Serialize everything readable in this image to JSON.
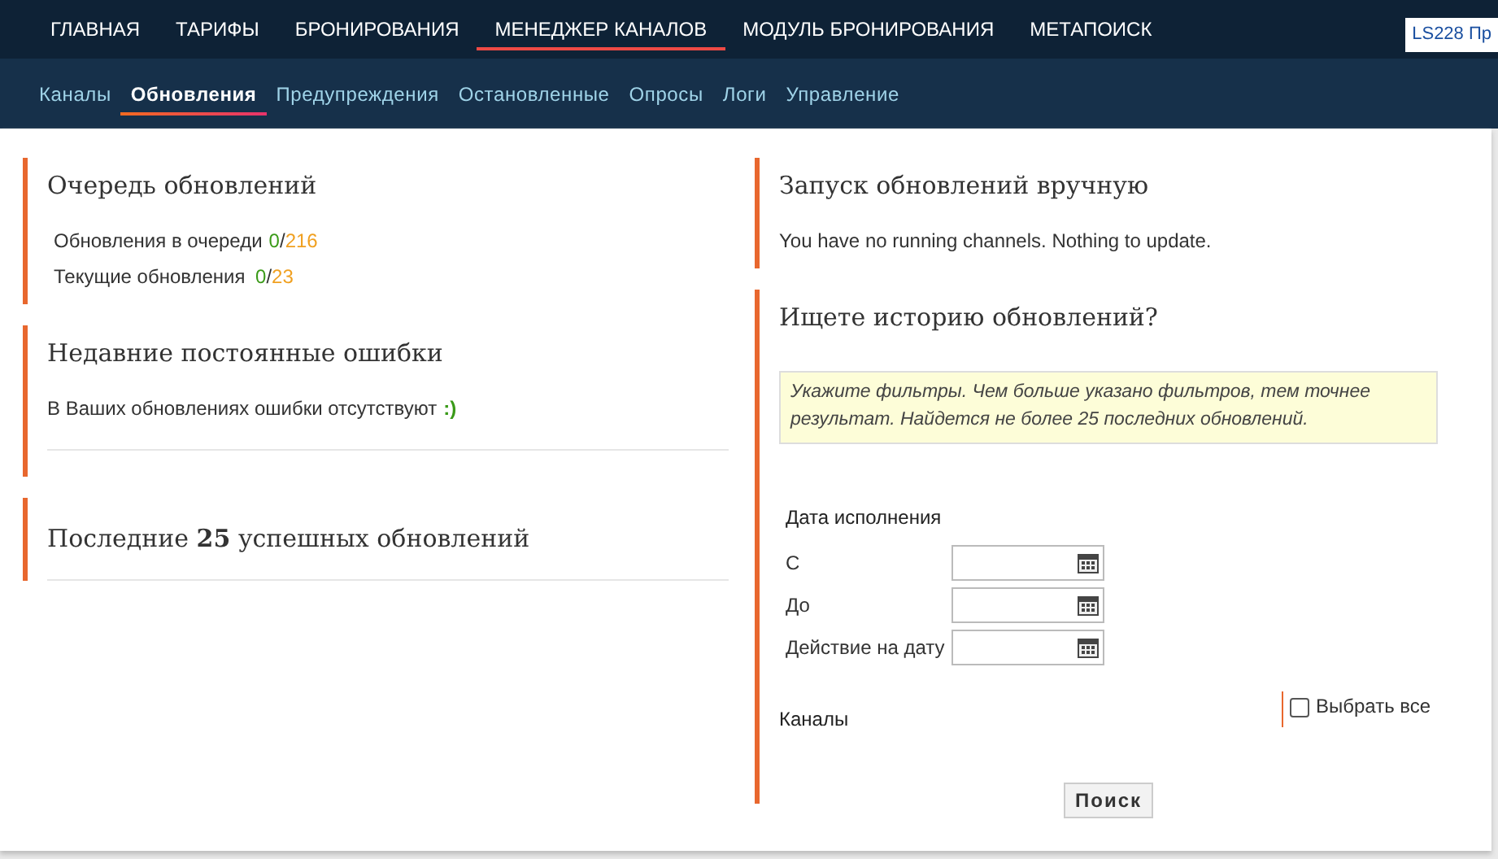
{
  "top_nav": [
    {
      "label": "ГЛАВНАЯ",
      "selected": false
    },
    {
      "label": "ТАРИФЫ",
      "selected": false
    },
    {
      "label": "БРОНИРОВАНИЯ",
      "selected": false
    },
    {
      "label": "МЕНЕДЖЕР КАНАЛОВ",
      "selected": true
    },
    {
      "label": "МОДУЛЬ БРОНИРОВАНИЯ",
      "selected": false
    },
    {
      "label": "МЕТАПОИСК",
      "selected": false
    }
  ],
  "account_badge": "LS228 Пр",
  "sub_nav": [
    {
      "label": "Каналы",
      "selected": false
    },
    {
      "label": "Обновления",
      "selected": true
    },
    {
      "label": "Предупреждения",
      "selected": false
    },
    {
      "label": "Остановленные",
      "selected": false
    },
    {
      "label": "Опросы",
      "selected": false
    },
    {
      "label": "Логи",
      "selected": false
    },
    {
      "label": "Управление",
      "selected": false
    }
  ],
  "queue": {
    "title": "Очередь обновлений",
    "rows": [
      {
        "label": "Обновления в очереди",
        "done": "0",
        "separator": "/",
        "total": "216"
      },
      {
        "label": "Текущие обновления",
        "done": "0",
        "separator": "/",
        "total": "23"
      }
    ]
  },
  "errors": {
    "title": "Недавние постоянные ошибки",
    "message": "В Ваших обновлениях ошибки отсутствуют",
    "smiley": ":)"
  },
  "recent": {
    "title": "Последние **25** успешных обновлений"
  },
  "manual": {
    "title": "Запуск обновлений вручную",
    "message": "You have no running channels. Nothing to update."
  },
  "history": {
    "title": "Ищете историю обновлений?",
    "hint": "Укажите фильтры. Чем больше указано фильтров, тем точнее результат. Найдется не более 25 последних обновлений.",
    "date_group": "Дата исполнения",
    "date_fields": [
      {
        "label": "С"
      },
      {
        "label": "До"
      },
      {
        "label": "Действие на дату"
      }
    ],
    "channels_label": "Каналы",
    "select_all": {
      "label": "Выбрать все",
      "checked": false
    },
    "search_button": "Поиск"
  }
}
